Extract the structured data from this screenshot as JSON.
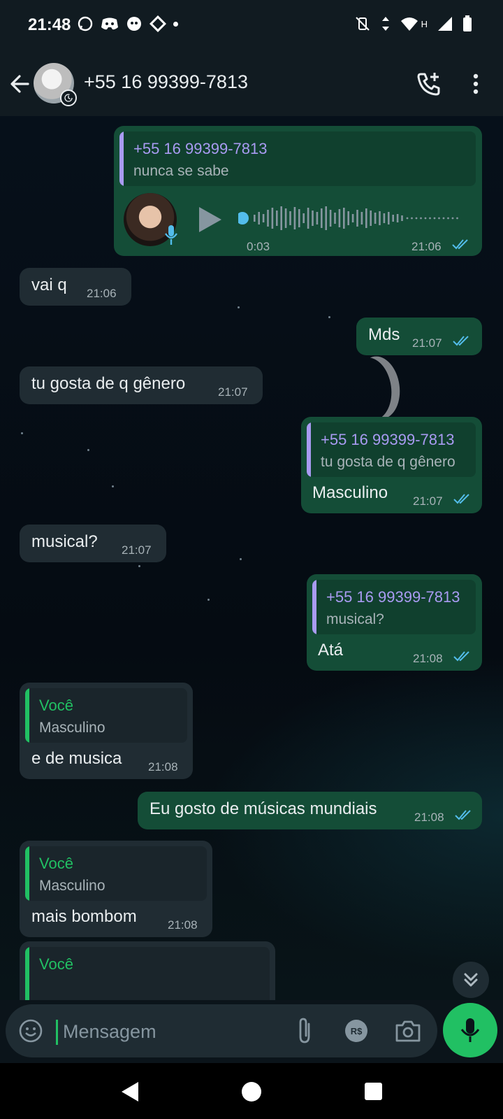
{
  "status_bar": {
    "time": "21:48",
    "network_label": "H"
  },
  "header": {
    "contact": "+55 16 99399-7813"
  },
  "messages": [
    {
      "quote_author": "+55 16 99399-7813",
      "quote_text": "nunca se sabe",
      "voice_duration": "0:03",
      "time": "21:06"
    },
    {
      "text": "vai q",
      "time": "21:06"
    },
    {
      "text": "Mds",
      "time": "21:07"
    },
    {
      "text": "tu gosta de q gênero",
      "time": "21:07"
    },
    {
      "quote_author": "+55 16 99399-7813",
      "quote_text": "tu gosta de q gênero",
      "text": "Masculino",
      "time": "21:07"
    },
    {
      "text": "musical?",
      "time": "21:07"
    },
    {
      "quote_author": "+55 16 99399-7813",
      "quote_text": "musical?",
      "text": "Atá",
      "time": "21:08"
    },
    {
      "quote_author": "Você",
      "quote_text": "Masculino",
      "text": "e de musica",
      "time": "21:08"
    },
    {
      "text": "Eu gosto de músicas mundiais",
      "time": "21:08"
    },
    {
      "quote_author": "Você",
      "quote_text": "Masculino",
      "text": "mais bombom",
      "time": "21:08"
    },
    {
      "quote_author": "Você"
    }
  ],
  "input": {
    "placeholder": "Mensagem",
    "value": ""
  },
  "colors": {
    "outgoing_bubble": "#144d37",
    "incoming_bubble": "#202c33",
    "accent_green": "#21c063",
    "quote_purple": "#a99bf2",
    "read_ticks": "#53bdeb"
  }
}
